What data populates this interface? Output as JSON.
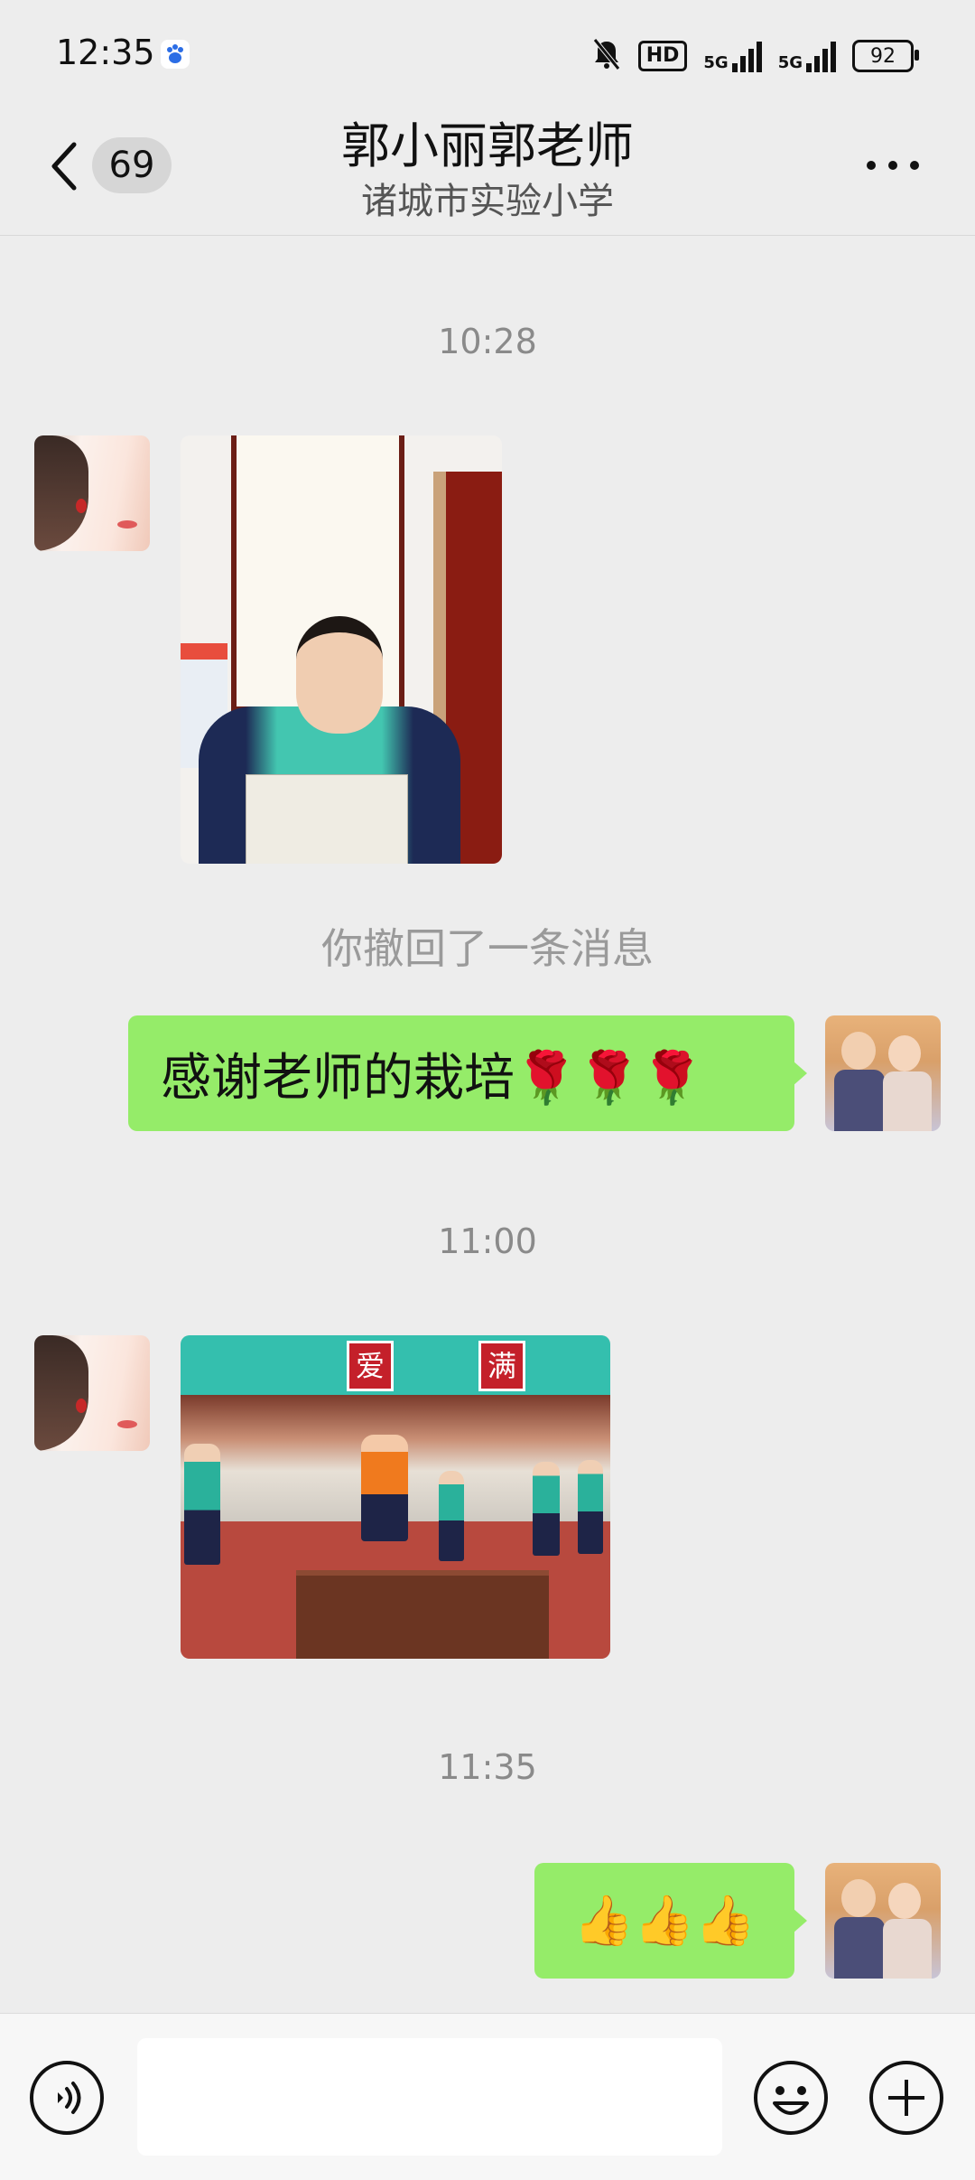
{
  "status_bar": {
    "time": "12:35",
    "hd_badge": "HD",
    "network_1": "5G",
    "network_2": "5G",
    "battery": "92",
    "icons": [
      "baidu-app-icon",
      "mute-bell-icon",
      "hd-badge",
      "5g-signal-icon",
      "5g-signal-icon",
      "battery-icon"
    ]
  },
  "header": {
    "back_icon": "chevron-left-icon",
    "unread_count": "69",
    "title": "郭小丽郭老师",
    "subtitle": "诸城市实验小学",
    "more_icon": "more-dots-icon"
  },
  "messages": [
    {
      "type": "timestamp",
      "text": "10:28"
    },
    {
      "type": "image",
      "sender": "other",
      "description": "girl holding booklet in front of calligraphy scroll"
    },
    {
      "type": "system",
      "text": "你撤回了一条消息"
    },
    {
      "type": "text",
      "sender": "me",
      "text": "感谢老师的栽培🌹🌹🌹"
    },
    {
      "type": "timestamp",
      "text": "11:00"
    },
    {
      "type": "image",
      "sender": "other",
      "description": "student speaking on stage in school courtyard"
    },
    {
      "type": "timestamp",
      "text": "11:35"
    },
    {
      "type": "text",
      "sender": "me",
      "text": "👍👍👍"
    }
  ],
  "photo_2_signs": [
    "爱",
    "满"
  ],
  "input_bar": {
    "voice_icon": "voice-wave-icon",
    "placeholder": "",
    "emoji_icon": "smiley-icon",
    "plus_icon": "plus-circle-icon"
  },
  "colors": {
    "background": "#ededed",
    "my_bubble": "#95ec69",
    "timestamp_text": "#8a8a8a"
  }
}
